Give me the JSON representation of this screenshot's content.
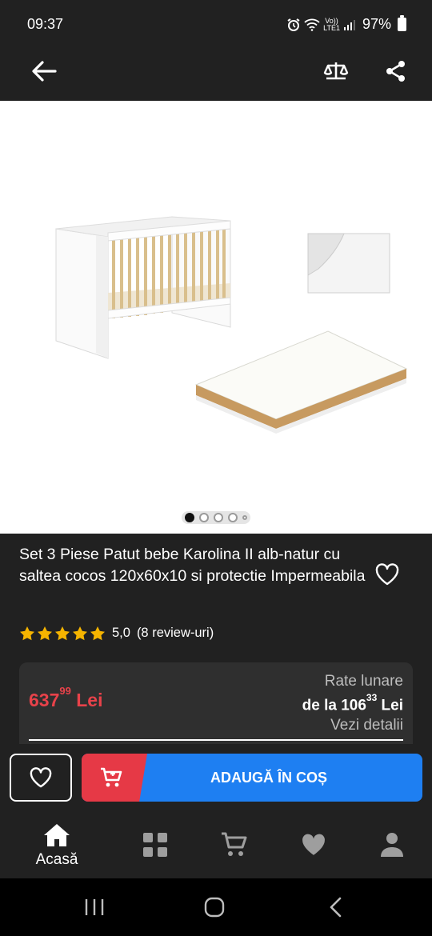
{
  "status_bar": {
    "time": "09:37",
    "network_label_top": "Vo))",
    "network_label_bottom": "LTE1",
    "battery": "97%"
  },
  "app_bar": {
    "back_icon": "arrow-left-icon",
    "compare_icon": "scales-icon",
    "share_icon": "share-icon"
  },
  "gallery": {
    "image_count": 5,
    "active_index": 0
  },
  "product": {
    "title": "Set 3 Piese Patut bebe Karolina II alb-natur cu saltea cocos 120x60x10 si protectie Impermeabila",
    "rating_value": "5,0",
    "rating_count": "(8 review-uri)",
    "stars": 5,
    "price_main": "637",
    "price_cents": "99",
    "price_currency": "Lei",
    "rates_label": "Rate lunare",
    "rates_prefix": "de la 106",
    "rates_cents": "33",
    "rates_currency": "Lei",
    "rates_details": "Vezi detalii"
  },
  "actions": {
    "add_to_cart_label": "ADAUGĂ ÎN COȘ"
  },
  "bottom_nav": {
    "home_label": "Acasă"
  },
  "colors": {
    "background": "#212121",
    "price_red": "#e8424a",
    "accent_blue": "#1e7ff2",
    "cart_red": "#e63946",
    "star": "#f5b400"
  }
}
